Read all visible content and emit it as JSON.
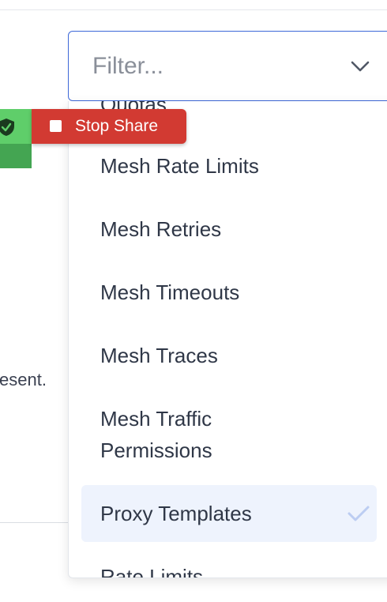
{
  "filter": {
    "placeholder": "Filter...",
    "value": ""
  },
  "dropdown": {
    "items": [
      {
        "label": "Quotas"
      },
      {
        "label": "Mesh Rate Limits"
      },
      {
        "label": "Mesh Retries"
      },
      {
        "label": "Mesh Timeouts"
      },
      {
        "label": "Mesh Traces"
      },
      {
        "label": "Mesh Traffic"
      },
      {
        "label": "Permissions"
      },
      {
        "label": "Proxy Templates",
        "selected": true
      },
      {
        "label": "Rate Limits"
      }
    ],
    "selected_check_icon": "check-icon"
  },
  "background": {
    "text_fragment": "esent."
  },
  "screen_share": {
    "shield_icon": "shield-check-icon",
    "stop_icon": "stop-square-icon",
    "stop_label": "Stop Share"
  },
  "colors": {
    "accent": "#3d68d8",
    "selected_bg": "#eef3fd",
    "check": "#bccdf2",
    "stop_share_red": "#d23a32",
    "share_green": "#5fce6a"
  }
}
